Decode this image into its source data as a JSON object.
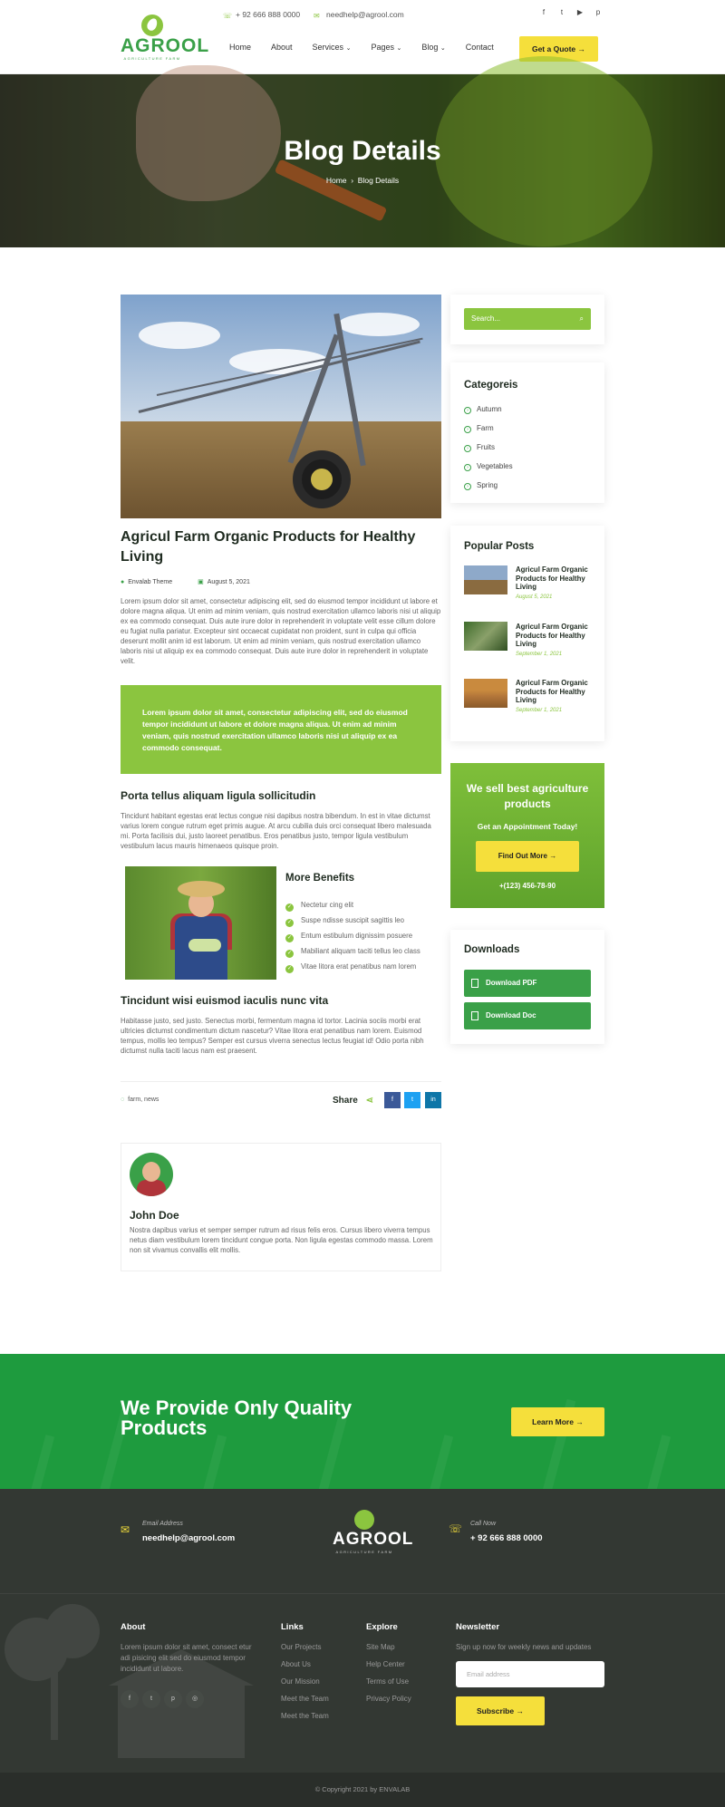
{
  "header": {
    "logo_name": "AGROOL",
    "logo_tagline": "AGRICULTURE FARM",
    "phone": "+ 92 666 888 0000",
    "email": "needhelp@agrool.com",
    "nav": [
      "Home",
      "About",
      "Services",
      "Pages",
      "Blog",
      "Contact"
    ],
    "quote_label": "Get a Quote"
  },
  "hero": {
    "title": "Blog Details",
    "crumb_home": "Home",
    "crumb_current": "Blog Details"
  },
  "post": {
    "title": "Agricul Farm Organic Products for Healthy Living",
    "author": "Envalab Theme",
    "date": "August 5, 2021",
    "intro": "Lorem ipsum dolor sit amet, consectetur adipiscing elit, sed do eiusmod tempor incididunt ut labore et dolore magna aliqua. Ut enim ad minim veniam, quis nostrud exercitation ullamco laboris nisi ut aliquip ex ea commodo consequat. Duis aute irure dolor in reprehenderit in voluptate velit esse cillum dolore eu fugiat nulla pariatur. Excepteur sint occaecat cupidatat non proident, sunt in culpa qui officia deserunt mollit anim id est laborum. Ut enim ad minim veniam, quis nostrud exercitation ullamco laboris nisi ut aliquip ex ea commodo consequat. Duis aute irure dolor in reprehenderit in voluptate velit.",
    "quote": "Lorem ipsum dolor sit amet, consectetur adipiscing elit, sed do eiusmod tempor incididunt ut labore et dolore magna aliqua. Ut enim ad minim veniam, quis nostrud exercitation ullamco laboris nisi ut aliquip ex ea commodo consequat.",
    "section1_title": "Porta tellus aliquam ligula sollicitudin",
    "section1_text": "Tincidunt habitant egestas erat lectus congue nisi dapibus nostra bibendum. In est in vitae dictumst varius lorem congue rutrum eget primis augue. At arcu cubilia duis orci consequat libero malesuada mi. Porta facilisis dui, justo laoreet penatibus. Eros penatibus justo, tempor ligula vestibulum vestibulum lacus mauris himenaeos quisque proin.",
    "benefits_title": "More Benefits",
    "benefits": [
      "Nectetur cing elit",
      "Suspe ndisse suscipit sagittis leo",
      "Entum estibulum dignissim posuere",
      "Mabiliant aliquam taciti tellus leo class",
      "Vitae litora erat penatibus nam lorem"
    ],
    "section2_title": "Tincidunt wisi euismod iaculis nunc vita",
    "section2_text": "Habitasse justo, sed justo. Senectus morbi, fermentum magna id tortor. Lacinia sociis morbi erat ultricies dictumst condimentum dictum nascetur? Vitae litora erat penatibus nam lorem. Euismod tempus, mollis leo tempus? Semper est cursus viverra senectus lectus feugiat id! Odio porta nibh dictumst nulla taciti lacus nam est praesent.",
    "tags": "farm, news",
    "share_label": "Share",
    "author_name": "John Doe",
    "author_bio": "Nostra dapibus varius et semper semper rutrum ad risus felis eros. Cursus libero viverra tempus netus diam vestibulum lorem tincidunt congue porta. Non ligula egestas commodo massa. Lorem non sit vivamus convallis elit mollis."
  },
  "sidebar": {
    "search_placeholder": "Search...",
    "categories_title": "Categoreis",
    "categories": [
      "Autumn",
      "Farm",
      "Fruits",
      "Vegetables",
      "Spring"
    ],
    "popular_title": "Popular Posts",
    "popular": [
      {
        "title": "Agricul Farm Organic Products for Healthy Living",
        "date": "August 5, 2021"
      },
      {
        "title": "Agricul Farm Organic Products for Healthy Living",
        "date": "September 1, 2021"
      },
      {
        "title": "Agricul Farm Organic Products for Healthy Living",
        "date": "September 1, 2021"
      }
    ],
    "promo_title": "We sell best agriculture products",
    "promo_sub": "Get an Appointment Today!",
    "promo_btn": "Find Out More",
    "promo_phone": "+(123) 456-78-90",
    "downloads_title": "Downloads",
    "download_pdf": "Download PDF",
    "download_doc": "Download Doc"
  },
  "cta": {
    "title": "We Provide Only Quality Products",
    "button": "Learn More"
  },
  "footer": {
    "email_label": "Email Address",
    "email": "needhelp@agrool.com",
    "call_label": "Call Now",
    "phone": "+ 92 666 888 0000",
    "about_title": "About",
    "about_text": "Lorem ipsum dolor sit amet, consect etur adi pisicing elit sed do eiusmod tempor incididunt ut labore.",
    "links_title": "Links",
    "links": [
      "Our Projects",
      "About Us",
      "Our Mission",
      "Meet the Team",
      "Meet the Team"
    ],
    "explore_title": "Explore",
    "explore": [
      "Site Map",
      "Help Center",
      "Terms of Use",
      "Privacy Policy"
    ],
    "newsletter_title": "Newsletter",
    "newsletter_text": "Sign up now for weekly news and updates",
    "email_placeholder": "Email address",
    "subscribe": "Subscribe",
    "copyright": "© Copyright 2021 by ENVALAB"
  },
  "colors": {
    "accent": "#8bc53f",
    "brand_green": "#1e9b3e",
    "yellow": "#f5df3b",
    "footer_bg": "#333833"
  }
}
